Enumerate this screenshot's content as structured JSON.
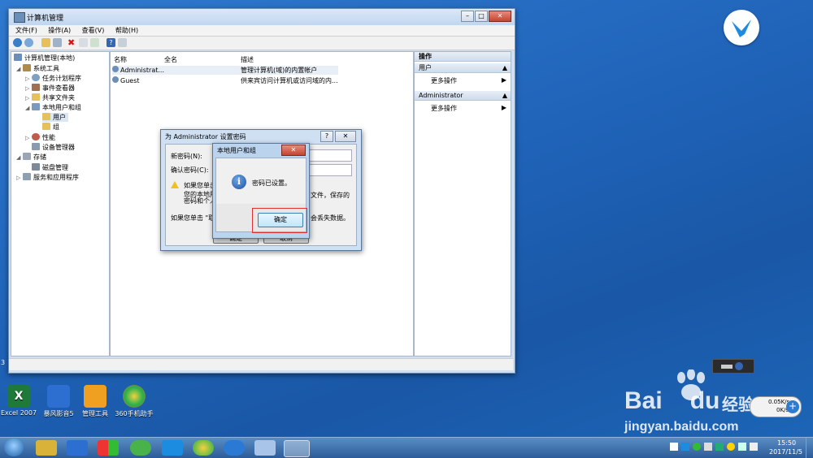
{
  "desktop": {
    "icons": [
      {
        "label": "Excel 2007",
        "icon": "excel-icon",
        "color": "#1f7a3a"
      },
      {
        "label": "暴风影音5",
        "icon": "storm-player-icon",
        "color": "#2d6fd0"
      },
      {
        "label": "管理工具",
        "icon": "admin-tools-icon",
        "color": "#f0a020"
      },
      {
        "label": "360手机助手",
        "icon": "360-assistant-icon",
        "color": "#27b34a"
      }
    ]
  },
  "main_window": {
    "title": "计算机管理",
    "menu": [
      "文件(F)",
      "操作(A)",
      "查看(V)",
      "帮助(H)"
    ],
    "tree": [
      {
        "label": "计算机管理(本地)",
        "icon": "computer-icon"
      },
      {
        "label": "系统工具",
        "icon": "tools-icon"
      },
      {
        "label": "任务计划程序",
        "icon": "clock-icon"
      },
      {
        "label": "事件查看器",
        "icon": "event-icon"
      },
      {
        "label": "共享文件夹",
        "icon": "folder-icon"
      },
      {
        "label": "本地用户和组",
        "icon": "users-icon"
      },
      {
        "label": "用户",
        "icon": "folder-icon"
      },
      {
        "label": "组",
        "icon": "folder-icon"
      },
      {
        "label": "性能",
        "icon": "perf-icon"
      },
      {
        "label": "设备管理器",
        "icon": "device-icon"
      },
      {
        "label": "存储",
        "icon": "storage-icon"
      },
      {
        "label": "磁盘管理",
        "icon": "disk-icon"
      },
      {
        "label": "服务和应用程序",
        "icon": "services-icon"
      }
    ],
    "columns": [
      "名称",
      "全名",
      "描述"
    ],
    "rows": [
      {
        "name": "Administrat...",
        "fullname": "",
        "desc": "管理计算机(域)的内置帐户"
      },
      {
        "name": "Guest",
        "fullname": "",
        "desc": "供来宾访问计算机或访问域的内..."
      }
    ],
    "actions": {
      "header": "操作",
      "sections": [
        {
          "title": "用户",
          "item": "更多操作"
        },
        {
          "title": "Administrator",
          "item": "更多操作"
        }
      ]
    }
  },
  "pwd_dialog": {
    "title": "为 Administrator 设置密码",
    "help": "?",
    "new_label": "新密码(N):",
    "confirm_label": "确认密码(C):",
    "warn1": "如果您单击",
    "warn2": "您的本地用",
    "warn3": "密码和个人",
    "warn_right": "文件，保存的",
    "info_left": "如果您单击 \"取",
    "info_right": "会丢失数据。",
    "ok": "确定",
    "cancel": "取消"
  },
  "msg_dialog": {
    "title": "本地用户和组",
    "message": "密码已设置。",
    "ok": "确定"
  },
  "watermark": {
    "brand": "Bai",
    "brand2": "du",
    "cn": "经验",
    "url": "jingyan.baidu.com"
  },
  "netspeed": {
    "up": "0.05K/s",
    "down": "0K/s"
  },
  "clock": {
    "time": "15:50",
    "date": "2017/11/5"
  },
  "left_edge_char": "3"
}
